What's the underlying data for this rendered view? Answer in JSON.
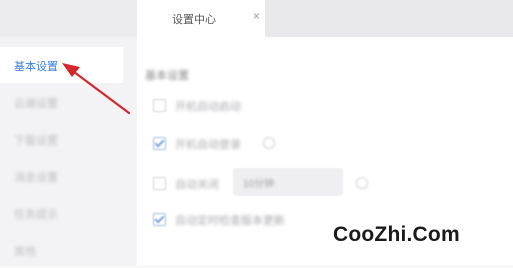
{
  "tab": {
    "title": "设置中心",
    "close_glyph": "×"
  },
  "sidebar": {
    "items": [
      {
        "label": "基本设置",
        "active": true
      },
      {
        "label": "云端设置",
        "active": false
      },
      {
        "label": "下载设置",
        "active": false
      },
      {
        "label": "消息设置",
        "active": false
      },
      {
        "label": "任务提示",
        "active": false
      },
      {
        "label": "其他",
        "active": false
      }
    ]
  },
  "main": {
    "section_title": "基本设置",
    "options": [
      {
        "label": "开机自动启动",
        "checked": false
      },
      {
        "label": "开机自动登录",
        "checked": true
      },
      {
        "label": "自动关闭",
        "checked": false,
        "value": "10分钟"
      },
      {
        "label": "自动定时检查版本更新",
        "checked": true
      }
    ]
  },
  "colors": {
    "accent": "#3b7ee0",
    "arrow": "#d3272b"
  },
  "icons": {
    "help": "help-circle-icon",
    "close": "close-icon"
  },
  "watermark": "CooZhi.Com"
}
